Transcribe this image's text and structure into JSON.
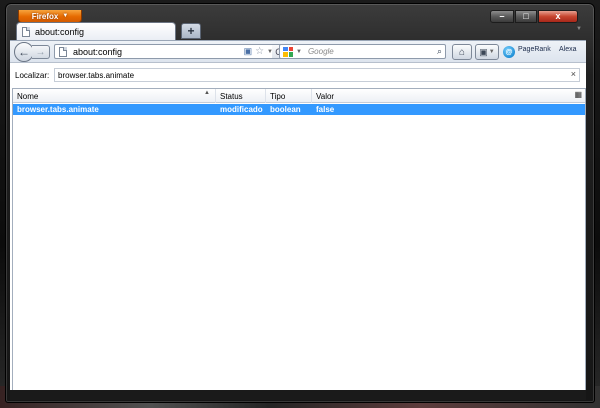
{
  "window": {
    "app_button_label": "Firefox",
    "controls": {
      "minimize": "–",
      "maximize": "□",
      "close": "x"
    }
  },
  "tabs": [
    {
      "label": "about:config",
      "active": true
    }
  ],
  "new_tab_label": "+",
  "toolbar": {
    "back_glyph": "←",
    "forward_glyph": "→",
    "url": "about:config",
    "reload_glyph": "C",
    "search_placeholder": "Google",
    "search_go_glyph": "⌕",
    "home_glyph": "⌂",
    "addon_glyph": "▣",
    "pagerank_label": "PageRank",
    "alexa_label": "Alexa"
  },
  "filter": {
    "label": "Localizar:",
    "value": "browser.tabs.animate",
    "clear_glyph": "×"
  },
  "table": {
    "columns": [
      "Nome",
      "Status",
      "Tipo",
      "Valor"
    ],
    "rows": [
      {
        "name": "browser.tabs.animate",
        "status": "modificado",
        "type": "boolean",
        "value": "false",
        "selected": true
      }
    ]
  },
  "colors": {
    "selection": "#3399ff",
    "firefox_orange": "#e66a00",
    "close_red": "#c7452f"
  },
  "icons": {
    "page": "page-icon",
    "bookmark": "bookmark-icon",
    "star": "star-icon",
    "google": "google-icon",
    "home": "home-icon",
    "pagerank": "pagerank-icon",
    "sort": "sort-ascending-icon",
    "column_picker": "column-picker-icon"
  }
}
